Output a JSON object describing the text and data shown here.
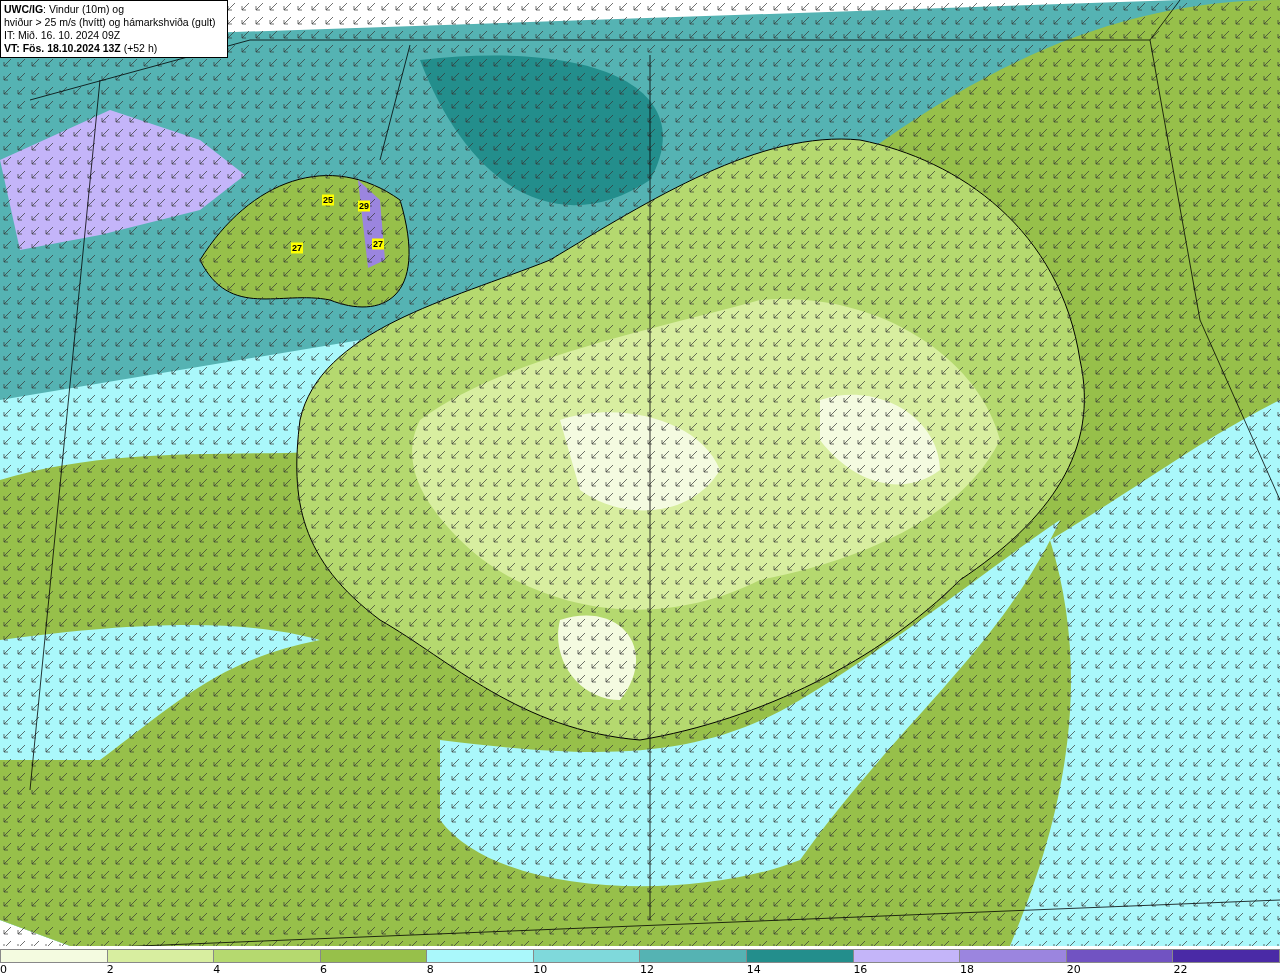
{
  "info_box": {
    "lines": [
      "**UWC/IG**: Vindur (10m) og",
      "hviður > 25 m/s (hvítt) og hámarkshviða (gult)",
      "IT: Mið. 16. 10. 2024 09Z",
      "**VT: Fös. 18.10.2024 13Z** (+52 h)"
    ]
  },
  "map": {
    "gust_labels": [
      {
        "value": "25"
      },
      {
        "value": "29"
      },
      {
        "value": "27"
      },
      {
        "value": "27"
      }
    ]
  },
  "legend": {
    "bins": [
      {
        "color": "#f4fbe0"
      },
      {
        "color": "#d8eea0"
      },
      {
        "color": "#b5d96f"
      },
      {
        "color": "#97c04a"
      },
      {
        "color": "#aaf8fb"
      },
      {
        "color": "#7fd9db"
      },
      {
        "color": "#55b3b3"
      },
      {
        "color": "#238e8c"
      },
      {
        "color": "#c4b5f9"
      },
      {
        "color": "#9b85df"
      },
      {
        "color": "#7153c2"
      },
      {
        "color": "#4a2aa6"
      }
    ],
    "labels": [
      "0",
      "2",
      "4",
      "6",
      "8",
      "10",
      "12",
      "14",
      "16",
      "18",
      "20",
      "22"
    ]
  }
}
